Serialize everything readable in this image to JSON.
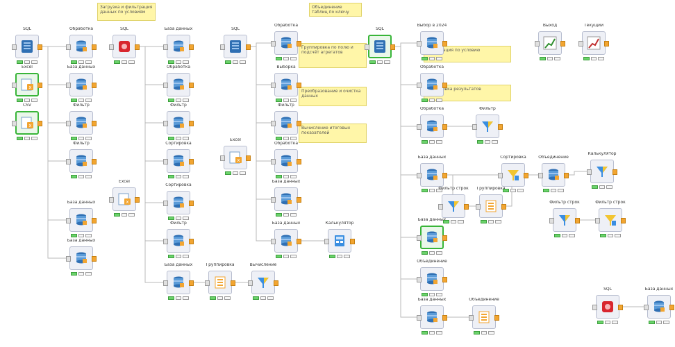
{
  "colors": {
    "canvas_bg": "#ffffff",
    "node_bg": "#eef0f6",
    "port": "#f2a531",
    "note_bg": "#fff6a8",
    "selected": "#38b538",
    "wire": "#b9b9b9"
  },
  "notes": {
    "n1": "Загрузка и фильтрация данных по условиям",
    "n2": "Объединение таблиц по ключу",
    "n3": "Группировка по полю и подсчёт агрегатов",
    "n4": "Преобразование и очистка данных",
    "n5": "Вычисление итоговых показателей",
    "n6": "Фильтрация по условию",
    "n7": "Сортировка результатов"
  },
  "nodes": {
    "src1": "SQL",
    "excel1": "Excel",
    "csv1": "CSV",
    "a1": "Обработка",
    "a2": "База данных",
    "a3": "Фильтр",
    "a4": "Фильтр",
    "a5": "База данных",
    "a6": "База данных",
    "red1": "SQL",
    "excel2": "Excel",
    "b1": "База данных",
    "b2": "Обработка",
    "b3": "Фильтр",
    "b4": "Сортировка",
    "b5": "Сортировка",
    "b6": "Фильтр",
    "b7": "База данных",
    "group1": "Группировка",
    "calc1": "Вычисление",
    "src2": "SQL",
    "excel3": "Excel",
    "c1": "Обработка",
    "c2": "Выборка",
    "c3": "Фильтр",
    "c4": "Обработка",
    "c5": "База данных",
    "c6": "База данных",
    "calc2": "Калькулятор",
    "src3": "SQL",
    "d1": "Выбор в 2024",
    "d2": "Обработка",
    "d3": "Обработка",
    "d4": "База данных",
    "d5": "База данных",
    "d6": "Объединение",
    "d7": "База данных",
    "e1": "Фильтр",
    "e2": "Фильтр строк",
    "e3": "Группировка",
    "e4": "Сортировка",
    "e5": "Объединение",
    "e6": "Калькулятор",
    "e7": "Фильтр строк",
    "e8": "Фильтр строк",
    "e9": "Объединение",
    "f1": "Выход",
    "f2": "Текущий",
    "red2": "SQL",
    "g1": "База данных"
  }
}
